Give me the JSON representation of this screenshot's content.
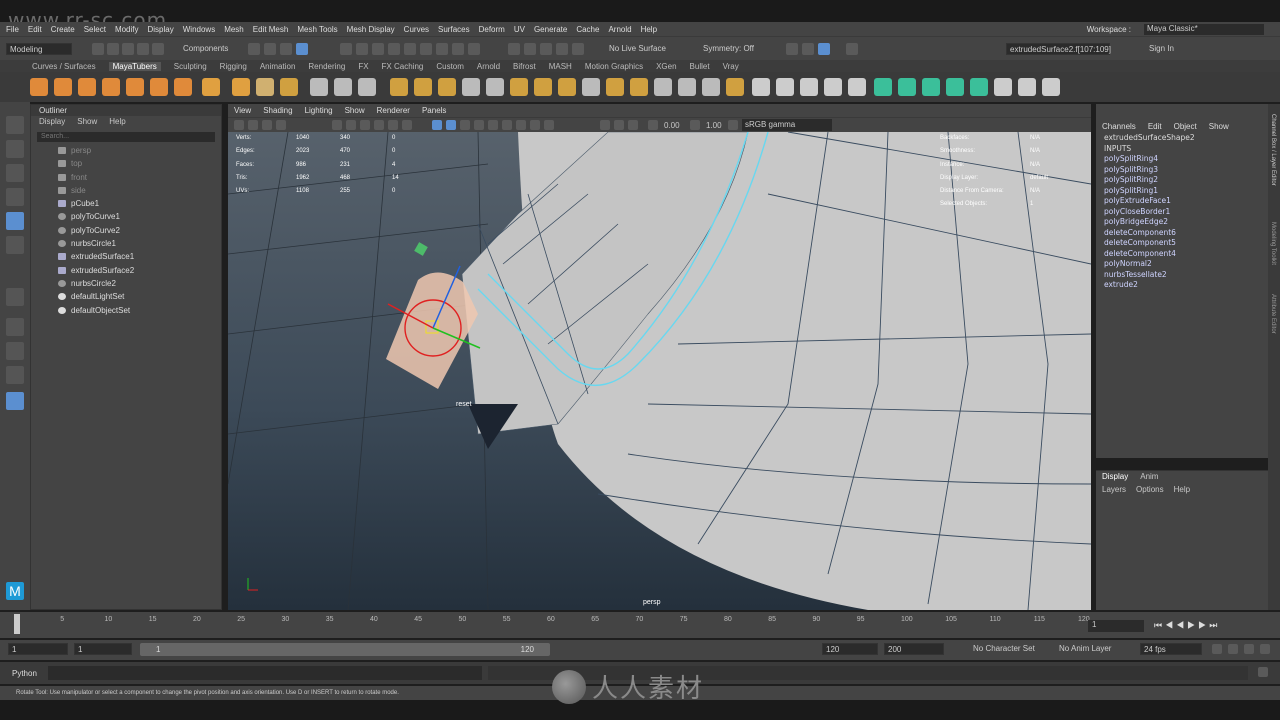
{
  "watermark": {
    "site": "www.rr-sc.com",
    "brand": "人人素材"
  },
  "menu": [
    "File",
    "Edit",
    "Create",
    "Select",
    "Modify",
    "Display",
    "Windows",
    "Mesh",
    "Edit Mesh",
    "Mesh Tools",
    "Mesh Display",
    "Curves",
    "Surfaces",
    "Deform",
    "UV",
    "Generate",
    "Cache",
    "Arnold",
    "Help"
  ],
  "workspace": {
    "label": "Workspace :",
    "value": "Maya Classic*"
  },
  "status": {
    "mode": "Modeling",
    "components": "Components",
    "live_surface": "No Live Surface",
    "symmetry": "Symmetry: Off",
    "selection_field": "extrudedSurface2.f[107:109]",
    "sign_in": "Sign In"
  },
  "shelf_tabs": [
    "Curves / Surfaces",
    "MayaTubers",
    "Sculpting",
    "Rigging",
    "Animation",
    "Rendering",
    "FX",
    "FX Caching",
    "Custom",
    "Arnold",
    "Bifrost",
    "MASH",
    "Motion Graphics",
    "XGen",
    "Bullet",
    "Vray"
  ],
  "shelf_active": "MayaTubers",
  "outliner": {
    "title": "Outliner",
    "menu": [
      "Display",
      "Show",
      "Help"
    ],
    "search_placeholder": "Search...",
    "items": [
      {
        "name": "persp",
        "dim": true
      },
      {
        "name": "top",
        "dim": true
      },
      {
        "name": "front",
        "dim": true
      },
      {
        "name": "side",
        "dim": true
      },
      {
        "name": "pCube1",
        "dim": false
      },
      {
        "name": "polyToCurve1",
        "dim": false
      },
      {
        "name": "polyToCurve2",
        "dim": false
      },
      {
        "name": "nurbsCircle1",
        "dim": false
      },
      {
        "name": "extrudedSurface1",
        "dim": false
      },
      {
        "name": "extrudedSurface2",
        "dim": false
      },
      {
        "name": "nurbsCircle2",
        "dim": false
      },
      {
        "name": "defaultLightSet",
        "dim": false
      },
      {
        "name": "defaultObjectSet",
        "dim": false
      }
    ]
  },
  "viewport": {
    "menu": [
      "View",
      "Shading",
      "Lighting",
      "Show",
      "Renderer",
      "Panels"
    ],
    "field_a": "0.00",
    "field_b": "1.00",
    "colorspace": "sRGB gamma",
    "camera": "persp",
    "reset_label": "reset",
    "hud_left": [
      {
        "label": "Verts:",
        "a": "1040",
        "b": "340",
        "c": "0"
      },
      {
        "label": "Edges:",
        "a": "2023",
        "b": "470",
        "c": "0"
      },
      {
        "label": "Faces:",
        "a": "986",
        "b": "231",
        "c": "4"
      },
      {
        "label": "Tris:",
        "a": "1962",
        "b": "468",
        "c": "14"
      },
      {
        "label": "UVs:",
        "a": "1108",
        "b": "255",
        "c": "0"
      }
    ],
    "hud_right": [
      {
        "label": "Backfaces:",
        "v": "N/A"
      },
      {
        "label": "Smoothness:",
        "v": "N/A"
      },
      {
        "label": "Instance:",
        "v": "N/A"
      },
      {
        "label": "Display Layer:",
        "v": "default"
      },
      {
        "label": "Distance From Camera:",
        "v": "N/A"
      },
      {
        "label": "Selected Objects:",
        "v": "1"
      }
    ]
  },
  "channel_box": {
    "menu": [
      "Channels",
      "Edit",
      "Object",
      "Show"
    ],
    "shape": "extrudedSurfaceShape2",
    "inputs_label": "INPUTS",
    "inputs": [
      "polySplitRing4",
      "polySplitRing3",
      "polySplitRing2",
      "polySplitRing1",
      "polyExtrudeFace1",
      "polyCloseBorder1",
      "polyBridgeEdge2",
      "deleteComponent6",
      "deleteComponent5",
      "deleteComponent4",
      "polyNormal2",
      "nurbsTessellate2",
      "extrude2"
    ]
  },
  "layer_editor": {
    "tabs": [
      "Display",
      "Anim"
    ],
    "menu": [
      "Layers",
      "Options",
      "Help"
    ]
  },
  "side_tabs": [
    "Channel Box / Layer Editor",
    "Modeling Toolkit",
    "Attribute Editor"
  ],
  "timeline": {
    "ticks": [
      "1",
      "5",
      "10",
      "15",
      "20",
      "25",
      "30",
      "35",
      "40",
      "45",
      "50",
      "55",
      "60",
      "65",
      "70",
      "75",
      "80",
      "85",
      "90",
      "95",
      "100",
      "105",
      "110",
      "115",
      "120"
    ],
    "current": "1",
    "current_field": "1"
  },
  "range": {
    "start": "1",
    "inner_start": "1",
    "slider_start": "1",
    "slider_end": "120",
    "end": "120",
    "max": "200",
    "character_set": "No Character Set",
    "anim_layer": "No Anim Layer",
    "fps": "24 fps"
  },
  "command_line": {
    "lang": "Python"
  },
  "help_line": "Rotate Tool: Use manipulator or select a component to change the pivot position and axis orientation. Use D or INSERT to return to rotate mode."
}
